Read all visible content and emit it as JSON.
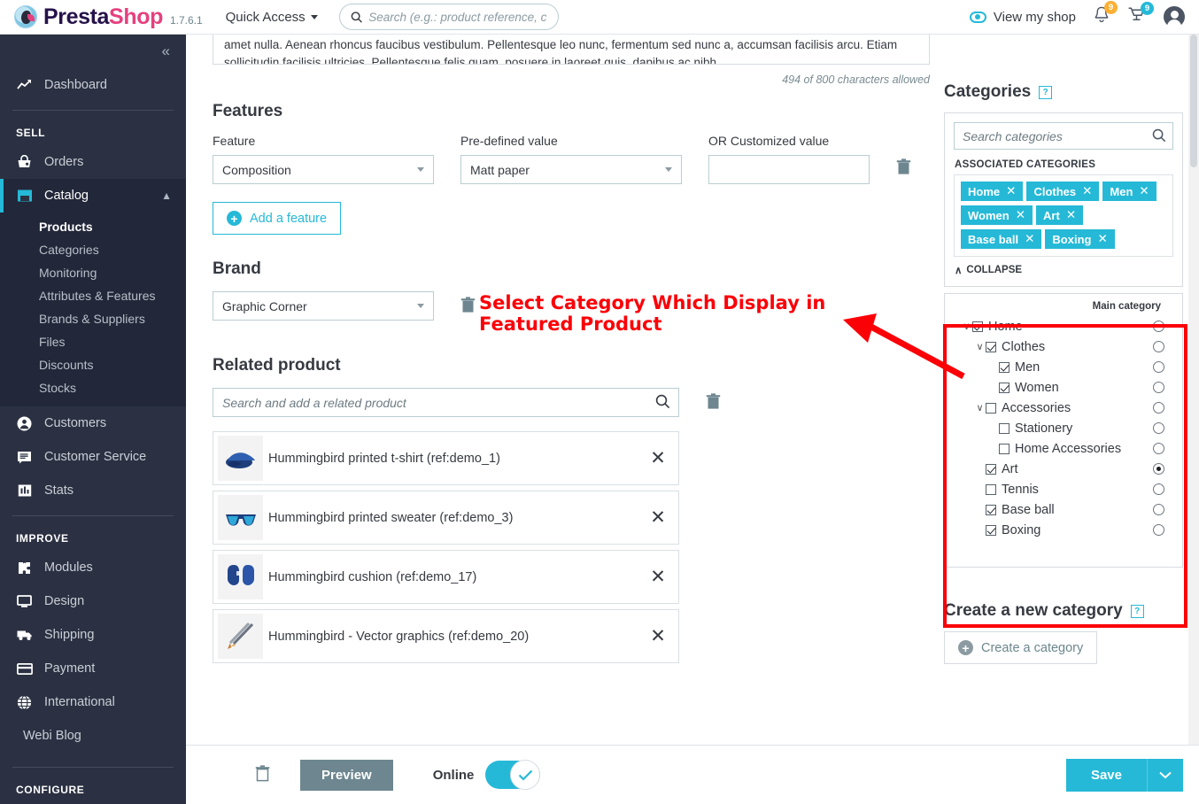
{
  "header": {
    "logo_name_a": "Presta",
    "logo_name_b": "Shop",
    "version": "1.7.6.1",
    "quick_access": "Quick Access",
    "search_placeholder": "Search (e.g.: product reference, custome",
    "view_my_shop": "View my shop",
    "bell_badge": "9",
    "cart_badge": "9"
  },
  "sidebar": {
    "dashboard": "Dashboard",
    "section_sell": "SELL",
    "section_improve": "IMPROVE",
    "section_configure": "CONFIGURE",
    "orders": "Orders",
    "catalog": "Catalog",
    "catalog_sub": [
      "Products",
      "Categories",
      "Monitoring",
      "Attributes & Features",
      "Brands & Suppliers",
      "Files",
      "Discounts",
      "Stocks"
    ],
    "customers": "Customers",
    "customer_service": "Customer Service",
    "stats": "Stats",
    "modules": "Modules",
    "design": "Design",
    "shipping": "Shipping",
    "payment": "Payment",
    "international": "International",
    "webi_blog": "Webi Blog"
  },
  "description": {
    "line1": "amet nulla. Aenean rhoncus faucibus vestibulum. Pellentesque leo nunc, fermentum sed nunc a, accumsan facilisis arcu. Etiam",
    "line2": "sollicitudin facilisis ultricies. Pellentesque felis quam, posuere in laoreet quis, dapibus ac nibh.",
    "char_count": "494 of 800 characters allowed"
  },
  "features": {
    "title": "Features",
    "label_feature": "Feature",
    "label_predefined": "Pre-defined value",
    "label_customized": "OR Customized value",
    "feature_value": "Composition",
    "predefined_value": "Matt paper",
    "customized_value": "",
    "add_button": "Add a feature"
  },
  "brand": {
    "title": "Brand",
    "value": "Graphic Corner"
  },
  "annotation": {
    "line1": "Select Category Which Display in",
    "line2": "Featured Product",
    "color": "#fb0007"
  },
  "related": {
    "title": "Related product",
    "search_placeholder": "Search and add a related product",
    "items": [
      {
        "name": "Hummingbird printed t-shirt (ref:demo_1)"
      },
      {
        "name": "Hummingbird printed sweater (ref:demo_3)"
      },
      {
        "name": "Hummingbird cushion (ref:demo_17)"
      },
      {
        "name": "Hummingbird - Vector graphics (ref:demo_20)"
      }
    ]
  },
  "categories": {
    "title": "Categories",
    "help": "?",
    "search_placeholder": "Search categories",
    "associated_title": "ASSOCIATED CATEGORIES",
    "tags": [
      "Home",
      "Clothes",
      "Men",
      "Women",
      "Art",
      "Base ball",
      "Boxing"
    ],
    "collapse": "COLLAPSE",
    "main_category_header": "Main category",
    "tree": [
      {
        "label": "Home",
        "depth": 0,
        "checked": true,
        "main": false,
        "toggle": true
      },
      {
        "label": "Clothes",
        "depth": 1,
        "checked": true,
        "main": false,
        "toggle": true
      },
      {
        "label": "Men",
        "depth": 2,
        "checked": true,
        "main": false,
        "toggle": false
      },
      {
        "label": "Women",
        "depth": 2,
        "checked": true,
        "main": false,
        "toggle": false
      },
      {
        "label": "Accessories",
        "depth": 1,
        "checked": false,
        "main": false,
        "toggle": true
      },
      {
        "label": "Stationery",
        "depth": 2,
        "checked": false,
        "main": false,
        "toggle": false
      },
      {
        "label": "Home Accessories",
        "depth": 2,
        "checked": false,
        "main": false,
        "toggle": false
      },
      {
        "label": "Art",
        "depth": 1,
        "checked": true,
        "main": true,
        "toggle": false
      },
      {
        "label": "Tennis",
        "depth": 1,
        "checked": false,
        "main": false,
        "toggle": false
      },
      {
        "label": "Base ball",
        "depth": 1,
        "checked": true,
        "main": false,
        "toggle": false
      },
      {
        "label": "Boxing",
        "depth": 1,
        "checked": true,
        "main": false,
        "toggle": false
      }
    ]
  },
  "create_category": {
    "title": "Create a new category",
    "help": "?",
    "button": "Create a category"
  },
  "footer": {
    "preview": "Preview",
    "online": "Online",
    "save": "Save"
  }
}
